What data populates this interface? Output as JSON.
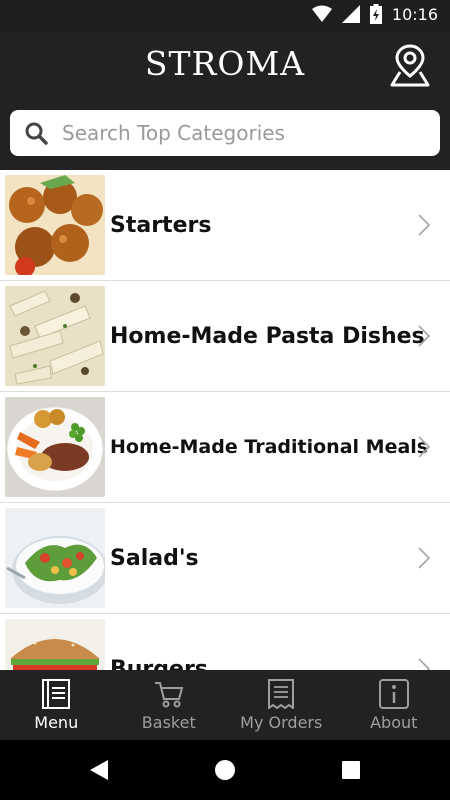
{
  "status_bar": {
    "time": "10:16"
  },
  "header": {
    "brand": "STROMA"
  },
  "search": {
    "placeholder": "Search Top Categories",
    "value": ""
  },
  "categories": [
    {
      "label": "Starters"
    },
    {
      "label": "Home-Made Pasta Dishes"
    },
    {
      "label": "Home-Made Traditional Meals"
    },
    {
      "label": "Salad's"
    },
    {
      "label": "Burgers"
    }
  ],
  "bottom_nav": [
    {
      "label": "Menu",
      "icon": "menu-book-icon",
      "active": true
    },
    {
      "label": "Basket",
      "icon": "cart-icon",
      "active": false
    },
    {
      "label": "My Orders",
      "icon": "receipt-icon",
      "active": false
    },
    {
      "label": "About",
      "icon": "info-icon",
      "active": false
    }
  ]
}
